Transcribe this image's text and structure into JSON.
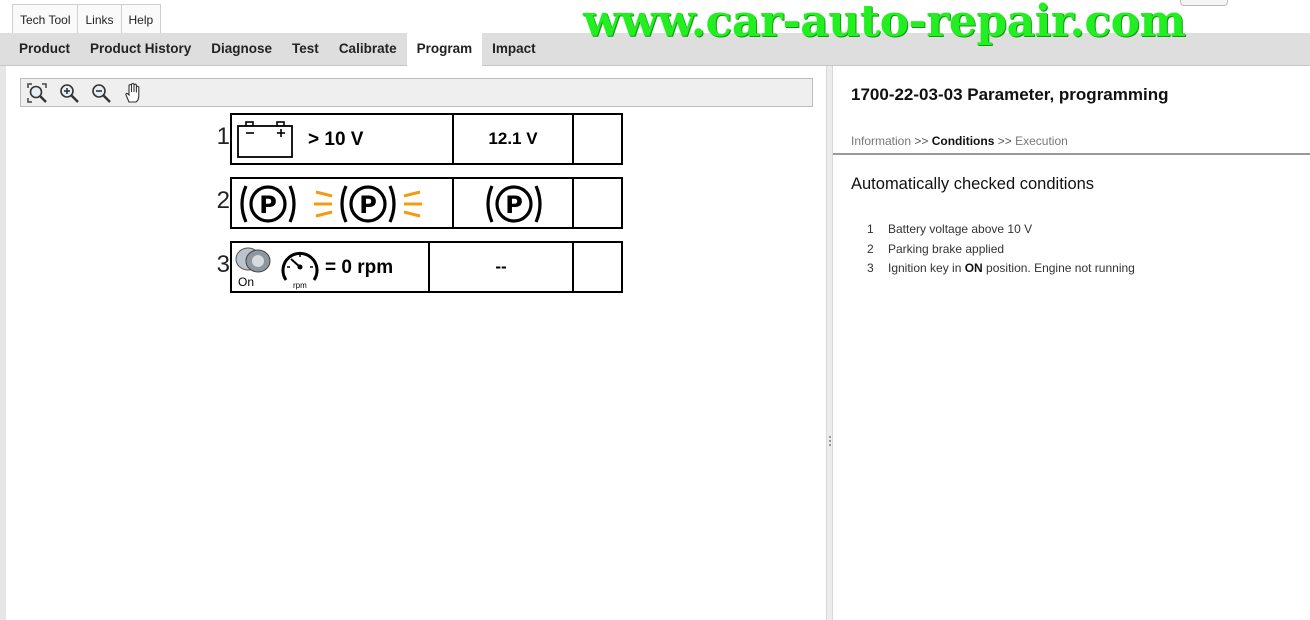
{
  "menu": {
    "items": [
      "Tech Tool",
      "Links",
      "Help"
    ]
  },
  "watermark": "www.car-auto-repair.com",
  "tabs": [
    {
      "label": "Product",
      "active": false
    },
    {
      "label": "Product History",
      "active": false
    },
    {
      "label": "Diagnose",
      "active": false
    },
    {
      "label": "Test",
      "active": false
    },
    {
      "label": "Calibrate",
      "active": false
    },
    {
      "label": "Program",
      "active": true
    },
    {
      "label": "Impact",
      "active": false
    }
  ],
  "toolbar": {
    "icons": [
      "zoom-fit-icon",
      "zoom-in-icon",
      "zoom-out-icon",
      "pan-hand-icon"
    ]
  },
  "conditions_graphic": [
    {
      "number": "1",
      "requirement": "> 10 V",
      "actual": "12.1 V",
      "icon": "battery-icon"
    },
    {
      "number": "2",
      "requirement": "",
      "actual": "",
      "icon": "parking-brake-icon"
    },
    {
      "number": "3",
      "requirement": "= 0 rpm",
      "actual": "--",
      "icon": "ignition-on-tachometer-icon",
      "ignition_label": "On",
      "rpm_label": "rpm"
    }
  ],
  "right": {
    "title": "1700-22-03-03 Parameter, programming",
    "breadcrumb": {
      "step1": "Information",
      "sep1": ">>",
      "step2": "Conditions",
      "sep2": ">>",
      "step3": "Execution"
    },
    "heading": "Automatically checked conditions",
    "list": [
      {
        "n": "1",
        "text": "Battery voltage above 10 V"
      },
      {
        "n": "2",
        "text": "Parking brake applied"
      },
      {
        "n": "3",
        "pre": "Ignition key in ",
        "bold": "ON",
        "post": " position. Engine not running"
      }
    ]
  },
  "colors": {
    "watermark": "#22ee22",
    "tab_bar": "#dedede",
    "brake_warning": "#f39c12",
    "divider": "#9a9a9a"
  }
}
